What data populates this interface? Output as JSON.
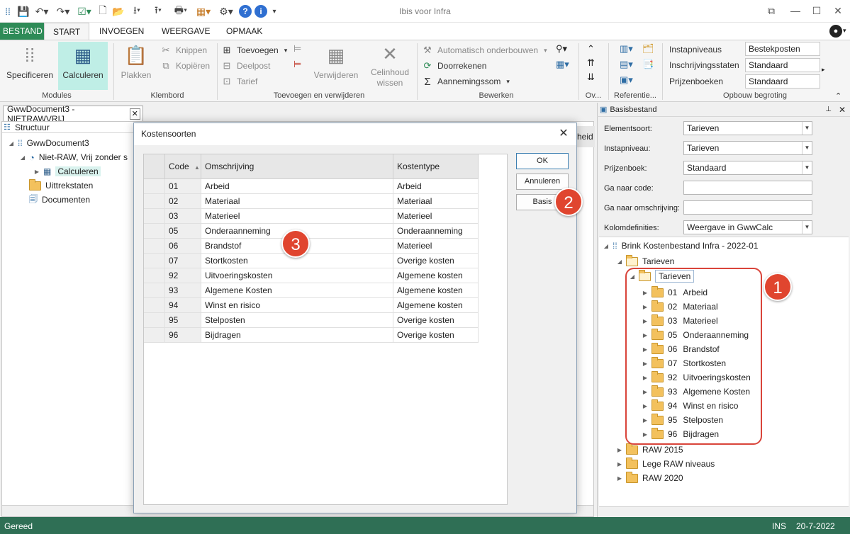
{
  "window": {
    "title": "Ibis voor Infra"
  },
  "ribbon": {
    "tabs": [
      "BESTAND",
      "START",
      "INVOEGEN",
      "WEERGAVE",
      "OPMAAK"
    ],
    "modules": {
      "label": "Modules",
      "specificeren": "Specificeren",
      "calculeren": "Calculeren"
    },
    "klembord": {
      "label": "Klembord",
      "plakken": "Plakken",
      "knippen": "Knippen",
      "kopieren": "Kopiëren"
    },
    "toevoegen": {
      "label": "Toevoegen en verwijderen",
      "toevoegen": "Toevoegen",
      "deelpost": "Deelpost",
      "tarief": "Tarief",
      "verwijderen": "Verwijderen",
      "celinhoud_1": "Celinhoud",
      "celinhoud_2": "wissen"
    },
    "bewerken": {
      "label": "Bewerken",
      "automatisch": "Automatisch onderbouwen",
      "doorrekenen": "Doorrekenen",
      "aanneming": "Aannemingssom"
    },
    "ov": {
      "label": "Ov..."
    },
    "referentie": {
      "label": "Referentie..."
    },
    "opbouw": {
      "label": "Opbouw begroting",
      "instapniveaus_label": "Instapniveaus",
      "instapniveaus_value": "Bestekposten",
      "inschrijving_label": "Inschrijvingsstaten",
      "inschrijving_value": "Standaard",
      "prijzenboeken_label": "Prijzenboeken",
      "prijzenboeken_value": "Standaard"
    }
  },
  "document": {
    "tab_label": "GwwDocument3 - NIETRAWVRIJ",
    "structuur": "Structuur",
    "tree": {
      "root": "GwwDocument3",
      "child": "Niet-RAW, Vrij zonder s",
      "calculeren": "Calculeren",
      "uittrekstaten": "Uittrekstaten",
      "documenten": "Documenten"
    },
    "partial_header": "heid"
  },
  "dialog": {
    "title": "Kostensoorten",
    "columns": [
      "Code",
      "Omschrijving",
      "Kostentype"
    ],
    "rows": [
      [
        "01",
        "Arbeid",
        "Arbeid"
      ],
      [
        "02",
        "Materiaal",
        "Materiaal"
      ],
      [
        "03",
        "Materieel",
        "Materieel"
      ],
      [
        "05",
        "Onderaanneming",
        "Onderaanneming"
      ],
      [
        "06",
        "Brandstof",
        "Materieel"
      ],
      [
        "07",
        "Stortkosten",
        "Overige kosten"
      ],
      [
        "92",
        "Uitvoeringskosten",
        "Algemene kosten"
      ],
      [
        "93",
        "Algemene Kosten",
        "Algemene kosten"
      ],
      [
        "94",
        "Winst en risico",
        "Algemene kosten"
      ],
      [
        "95",
        "Stelposten",
        "Overige kosten"
      ],
      [
        "96",
        "Bijdragen",
        "Overige kosten"
      ]
    ],
    "ok": "OK",
    "annuleren": "Annuleren",
    "basis": "Basis"
  },
  "basisbestand": {
    "title": "Basisbestand",
    "elementsoort_label": "Elementsoort:",
    "elementsoort_value": "Tarieven",
    "instapniveau_label": "Instapniveau:",
    "instapniveau_value": "Tarieven",
    "prijzenboek_label": "Prijzenboek:",
    "prijzenboek_value": "Standaard",
    "code_label": "Ga naar code:",
    "omschrijving_label": "Ga naar omschrijving:",
    "kolom_label": "Kolomdefinities:",
    "kolom_value": "Weergave in GwwCalc",
    "tree_root": "Brink Kostenbestand Infra - 2022-01",
    "tarieven_1": "Tarieven",
    "tarieven_2": "Tarieven",
    "items": [
      [
        "01",
        "Arbeid"
      ],
      [
        "02",
        "Materiaal"
      ],
      [
        "03",
        "Materieel"
      ],
      [
        "05",
        "Onderaanneming"
      ],
      [
        "06",
        "Brandstof"
      ],
      [
        "07",
        "Stortkosten"
      ],
      [
        "92",
        "Uitvoeringskosten"
      ],
      [
        "93",
        "Algemene Kosten"
      ],
      [
        "94",
        "Winst en risico"
      ],
      [
        "95",
        "Stelposten"
      ],
      [
        "96",
        "Bijdragen"
      ]
    ],
    "other_folders": [
      "RAW 2015",
      "Lege RAW niveaus",
      "RAW 2020"
    ]
  },
  "callouts": [
    "1",
    "2",
    "3"
  ],
  "status": {
    "left": "Gereed",
    "mode": "INS",
    "date": "20-7-2022"
  },
  "colors": {
    "accent": "#2e8b57",
    "statusbar": "#2f6f55",
    "callout": "#e0452f"
  }
}
